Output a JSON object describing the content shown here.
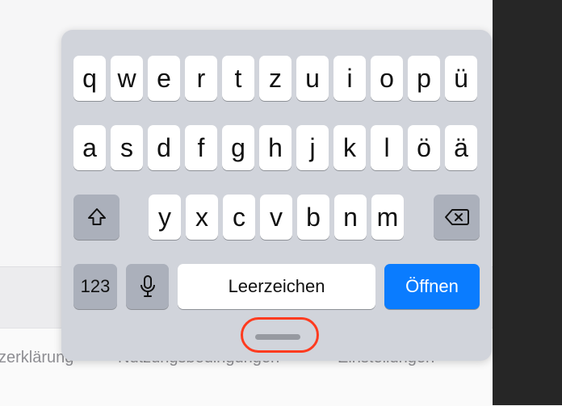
{
  "background": {
    "footer_links": [
      "zerklärung",
      "Nutzungsbedingungen",
      "Einstellungen"
    ]
  },
  "keyboard": {
    "row1": [
      "q",
      "w",
      "e",
      "r",
      "t",
      "z",
      "u",
      "i",
      "o",
      "p",
      "ü"
    ],
    "row2": [
      "a",
      "s",
      "d",
      "f",
      "g",
      "h",
      "j",
      "k",
      "l",
      "ö",
      "ä"
    ],
    "row3": [
      "y",
      "x",
      "c",
      "v",
      "b",
      "n",
      "m"
    ],
    "numbers_label": "123",
    "space_label": "Leerzeichen",
    "return_label": "Öffnen",
    "shift_icon": "shift-icon",
    "delete_icon": "backspace-icon",
    "mic_icon": "microphone-icon"
  },
  "colors": {
    "accent": "#0a7cff",
    "highlight": "#ff3b1f",
    "keyboard_bg": "#d1d4db",
    "dark_panel": "#262626"
  }
}
